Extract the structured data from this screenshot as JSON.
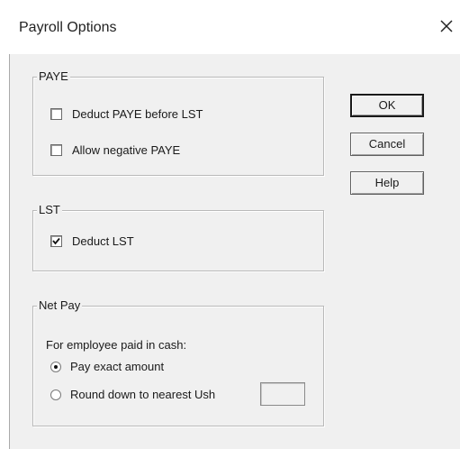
{
  "window": {
    "title": "Payroll Options",
    "close_icon": "close-icon"
  },
  "paye_group": {
    "legend": "PAYE",
    "options": [
      {
        "label": "Deduct PAYE before LST",
        "checked": false
      },
      {
        "label": "Allow negative PAYE",
        "checked": false
      }
    ]
  },
  "lst_group": {
    "legend": "LST",
    "options": [
      {
        "label": "Deduct LST",
        "checked": true
      }
    ]
  },
  "netpay_group": {
    "legend": "Net Pay",
    "description": "For employee paid in cash:",
    "options": [
      {
        "label": "Pay exact amount",
        "selected": true
      },
      {
        "label": "Round down to nearest Ush",
        "selected": false
      }
    ],
    "round_value": ""
  },
  "buttons": {
    "ok": "OK",
    "cancel": "Cancel",
    "help": "Help"
  }
}
